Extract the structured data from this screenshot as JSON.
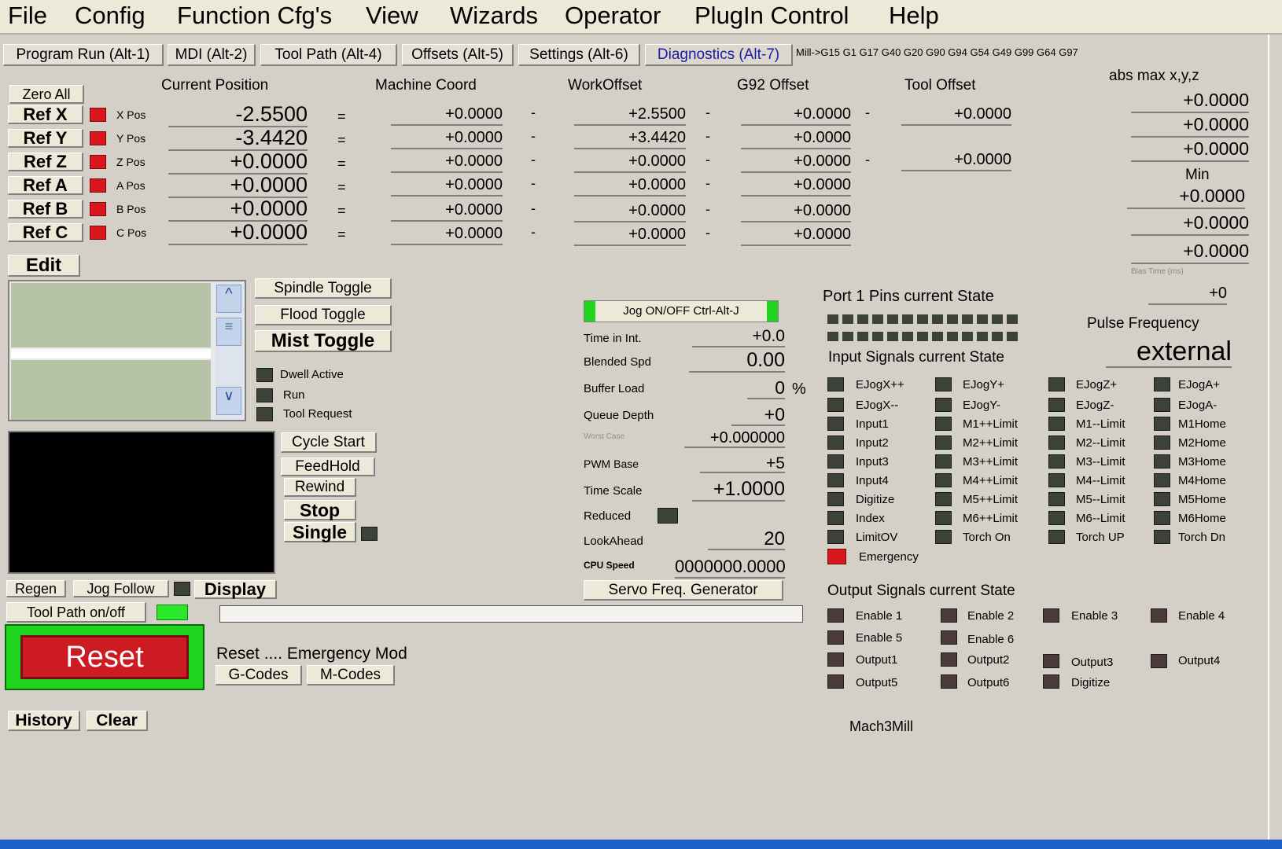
{
  "menu": [
    "File",
    "Config",
    "Function Cfg's",
    "View",
    "Wizards",
    "Operator",
    "PlugIn Control",
    "Help"
  ],
  "tabs": [
    "Program Run (Alt-1)",
    "MDI (Alt-2)",
    "Tool Path (Alt-4)",
    "Offsets (Alt-5)",
    "Settings (Alt-6)",
    "Diagnostics (Alt-7)"
  ],
  "modal_line": "Mill->G15  G1 G17 G40 G20 G90 G94 G54 G49 G99 G64 G97",
  "headers": {
    "current": "Current Position",
    "machine": "Machine Coord",
    "work": "WorkOffset",
    "g92": "G92 Offset",
    "tool": "Tool Offset",
    "absmax": "abs max x,y,z",
    "min": "Min"
  },
  "zero_all": "Zero All",
  "axes": [
    {
      "ref": "Ref X",
      "pos": "X Pos",
      "current": "-2.5500",
      "machine": "+0.0000",
      "work": "+2.5500",
      "g92": "+0.0000",
      "tool": "+0.0000"
    },
    {
      "ref": "Ref Y",
      "pos": "Y Pos",
      "current": "-3.4420",
      "machine": "+0.0000",
      "work": "+3.4420",
      "g92": "+0.0000",
      "tool": ""
    },
    {
      "ref": "Ref Z",
      "pos": "Z Pos",
      "current": "+0.0000",
      "machine": "+0.0000",
      "work": "+0.0000",
      "g92": "+0.0000",
      "tool": "+0.0000"
    },
    {
      "ref": "Ref A",
      "pos": "A Pos",
      "current": "+0.0000",
      "machine": "+0.0000",
      "work": "+0.0000",
      "g92": "+0.0000",
      "tool": ""
    },
    {
      "ref": "Ref B",
      "pos": "B Pos",
      "current": "+0.0000",
      "machine": "+0.0000",
      "work": "+0.0000",
      "g92": "+0.0000",
      "tool": ""
    },
    {
      "ref": "Ref C",
      "pos": "C Pos",
      "current": "+0.0000",
      "machine": "+0.0000",
      "work": "+0.0000",
      "g92": "+0.0000",
      "tool": ""
    }
  ],
  "equals": "=",
  "dash": "-",
  "absmax": [
    "+0.0000",
    "+0.0000",
    "+0.0000"
  ],
  "min": [
    "+0.0000",
    "+0.0000",
    "+0.0000"
  ],
  "bias_time_label": "Bias Time (ms)",
  "bias_time": "+0",
  "edit": "Edit",
  "toggles": {
    "spindle": "Spindle Toggle",
    "flood": "Flood Toggle",
    "mist": "Mist Toggle"
  },
  "status_leds": {
    "dwell": "Dwell Active",
    "run": "Run",
    "tool_request": "Tool Request"
  },
  "controls": {
    "cycle_start": "Cycle Start",
    "feedhold": "FeedHold",
    "rewind": "Rewind",
    "stop": "Stop",
    "single": "Single"
  },
  "display_row": {
    "regen": "Regen",
    "jog_follow": "Jog Follow",
    "display": "Display"
  },
  "toolpath_onoff": "Tool Path on/off",
  "reset": "Reset",
  "reset_msg": "Reset .... Emergency Mod",
  "gcodes": "G-Codes",
  "mcodes": "M-Codes",
  "history": "History",
  "clear": "Clear",
  "jog_toggle": "Jog ON/OFF Ctrl-Alt-J",
  "stats": [
    {
      "label": "Time in Int.",
      "value": "+0.0"
    },
    {
      "label": "Blended Spd",
      "value": "0.00"
    },
    {
      "label": "Buffer Load",
      "value": "0"
    },
    {
      "label": "Queue Depth",
      "value": "+0"
    },
    {
      "label": "Worst Case",
      "value": "+0.000000"
    },
    {
      "label": "PWM Base",
      "value": "+5"
    },
    {
      "label": "Time Scale",
      "value": "+1.0000"
    },
    {
      "label": "Reduced",
      "value": ""
    },
    {
      "label": "LookAhead",
      "value": "20"
    },
    {
      "label": "CPU Speed",
      "value": "0000000.0000"
    }
  ],
  "percent": "%",
  "servo_btn": "Servo Freq. Generator",
  "port_title": "Port 1 Pins current State",
  "pulse_title": "Pulse Frequency",
  "pulse_value": "external",
  "input_title": "Input Signals current State",
  "inputs": [
    [
      "EJogX++",
      "EJogY+",
      "EJogZ+",
      "EJogA+"
    ],
    [
      "EJogX--",
      "EJogY-",
      "EJogZ-",
      "EJogA-"
    ],
    [
      "Input1",
      "M1++Limit",
      "M1--Limit",
      "M1Home"
    ],
    [
      "Input2",
      "M2++Limit",
      "M2--Limit",
      "M2Home"
    ],
    [
      "Input3",
      "M3++Limit",
      "M3--Limit",
      "M3Home"
    ],
    [
      "Input4",
      "M4++Limit",
      "M4--Limit",
      "M4Home"
    ],
    [
      "Digitize",
      "M5++Limit",
      "M5--Limit",
      "M5Home"
    ],
    [
      "Index",
      "M6++Limit",
      "M6--Limit",
      "M6Home"
    ],
    [
      "LimitOV",
      "Torch On",
      "Torch UP",
      "Torch Dn"
    ]
  ],
  "emergency": "Emergency",
  "output_title": "Output Signals current State",
  "outputs": [
    [
      "Enable 1",
      "Enable 2",
      "Enable 3",
      "Enable 4"
    ],
    [
      "Enable 5",
      "Enable 6"
    ],
    [
      "Output1",
      "Output2",
      "Output3",
      "Output4"
    ],
    [
      "Output5",
      "Output6",
      "Digitize"
    ]
  ],
  "profile": "Mach3Mill",
  "colors": {
    "led_red": "#d9161c",
    "led_green": "#28e828",
    "led_dark": "#3d4238",
    "bg": "#d4d0c8"
  }
}
